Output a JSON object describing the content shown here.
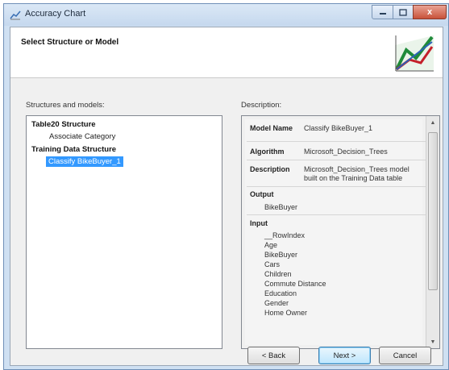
{
  "window": {
    "title": "Accuracy Chart",
    "close_glyph": "x",
    "min_glyph": "",
    "max_glyph": ""
  },
  "header": {
    "title": "Select Structure or Model",
    "logo_icon": "accuracy-chart-logo"
  },
  "left": {
    "label": "Structures and models:",
    "tree": [
      {
        "label": "Table20 Structure",
        "bold": true
      },
      {
        "label": "Associate Category",
        "bold": false
      },
      {
        "label": "Training Data Structure",
        "bold": true
      },
      {
        "label": "Classify BikeBuyer_1",
        "selected": true
      }
    ]
  },
  "description": {
    "label": "Description:",
    "model_name_label": "Model Name",
    "model_name_value": "Classify BikeBuyer_1",
    "algorithm_label": "Algorithm",
    "algorithm_value": "Microsoft_Decision_Trees",
    "description_label": "Description",
    "description_value_line1": "Microsoft_Decision_Trees model",
    "description_value_line2": "built on the Training Data table",
    "output_label": "Output",
    "output_value": "BikeBuyer",
    "input_label": "Input",
    "inputs": [
      "__RowIndex",
      "Age",
      "BikeBuyer",
      "Cars",
      "Children",
      "Commute Distance",
      "Education",
      "Gender",
      "Home Owner"
    ]
  },
  "buttons": {
    "back": "< Back",
    "next": "Next >",
    "cancel": "Cancel"
  }
}
